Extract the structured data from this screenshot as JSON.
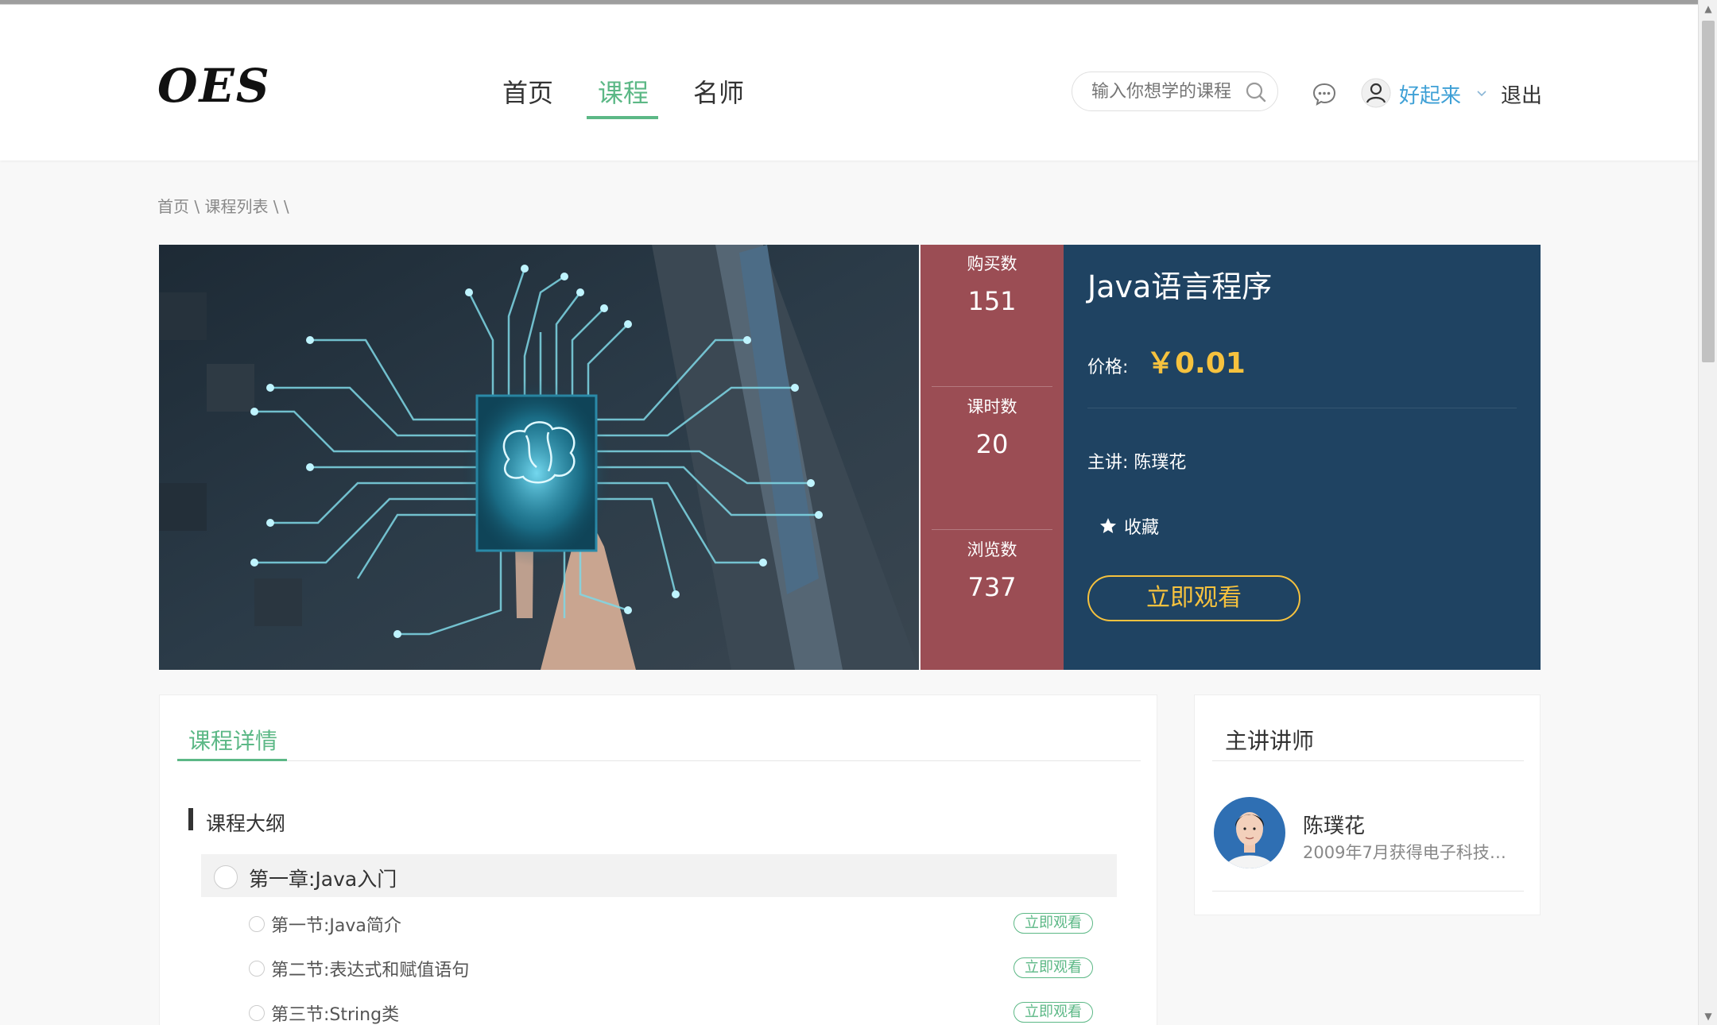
{
  "header": {
    "logo": "OES",
    "nav": [
      {
        "label": "首页",
        "active": false
      },
      {
        "label": "课程",
        "active": true
      },
      {
        "label": "名师",
        "active": false
      }
    ],
    "search_placeholder": "输入你想学的课程",
    "username": "好起来",
    "logout": "退出"
  },
  "breadcrumb": {
    "text": "首页 \\ 课程列表 \\ \\"
  },
  "course": {
    "stats": [
      {
        "label": "购买数",
        "value": "151"
      },
      {
        "label": "课时数",
        "value": "20"
      },
      {
        "label": "浏览数",
        "value": "737"
      }
    ],
    "title": "Java语言程序",
    "price_label": "价格:",
    "price": "￥0.01",
    "teacher_line": "主讲:  陈璞花",
    "favorite": "收藏",
    "watch_button": "立即观看"
  },
  "detail": {
    "tab": "课程详情",
    "outline_title": "课程大纲",
    "chapter": "第一章:Java入门",
    "lessons": [
      {
        "title": "第一节:Java简介",
        "button": "立即观看"
      },
      {
        "title": "第二节:表达式和赋值语句",
        "button": "立即观看"
      },
      {
        "title": "第三节:String类",
        "button": "立即观看"
      }
    ]
  },
  "teacher": {
    "heading": "主讲讲师",
    "name": "陈璞花",
    "description": "2009年7月获得电子科技大..."
  },
  "colors": {
    "accent_green": "#5cb886",
    "stats_bg": "#9b4d54",
    "info_bg": "#1f4362",
    "price_gold": "#f6c23e",
    "username_blue": "#3ea0d6"
  },
  "icons": [
    "search-icon",
    "message-icon",
    "user-avatar-icon",
    "chevron-down-icon",
    "star-icon"
  ]
}
